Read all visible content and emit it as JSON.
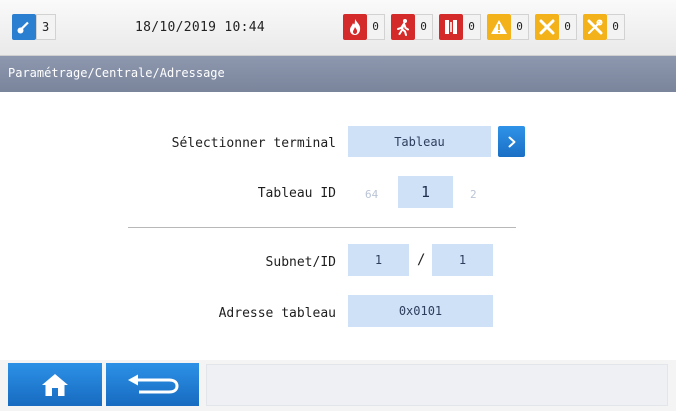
{
  "status": {
    "user_level": "3",
    "datetime": "18/10/2019 10:44",
    "counters": [
      {
        "icon": "fire-icon",
        "color": "#d42a2a",
        "count": "0"
      },
      {
        "icon": "evacuation-icon",
        "color": "#d42a2a",
        "count": "0"
      },
      {
        "icon": "door-icon",
        "color": "#d42a2a",
        "count": "0"
      },
      {
        "icon": "warning-icon",
        "color": "#f3b21a",
        "count": "0"
      },
      {
        "icon": "fault-icon",
        "color": "#f3b21a",
        "count": "0"
      },
      {
        "icon": "disabled-icon",
        "color": "#f3b21a",
        "count": "0"
      }
    ]
  },
  "breadcrumb": "Paramétrage/Centrale/Adressage",
  "form": {
    "select_terminal_label": "Sélectionner terminal",
    "select_terminal_value": "Tableau",
    "panel_id_label": "Tableau ID",
    "panel_id_prev": "64",
    "panel_id_value": "1",
    "panel_id_next": "2",
    "subnet_label": "Subnet/ID",
    "subnet_value": "1",
    "separator": "/",
    "id_value": "1",
    "address_label": "Adresse tableau",
    "address_value": "0x0101"
  },
  "colors": {
    "accent_blue": "#1a6fc4",
    "field_blue": "#cfe1f7",
    "crumb_bar": "#7f8aa1",
    "alarm_red": "#d42a2a",
    "fault_yellow": "#f3b21a"
  },
  "icons": {
    "user": "key-icon",
    "next": "chevron-right-icon",
    "home": "home-icon",
    "back": "back-arrow-icon"
  }
}
